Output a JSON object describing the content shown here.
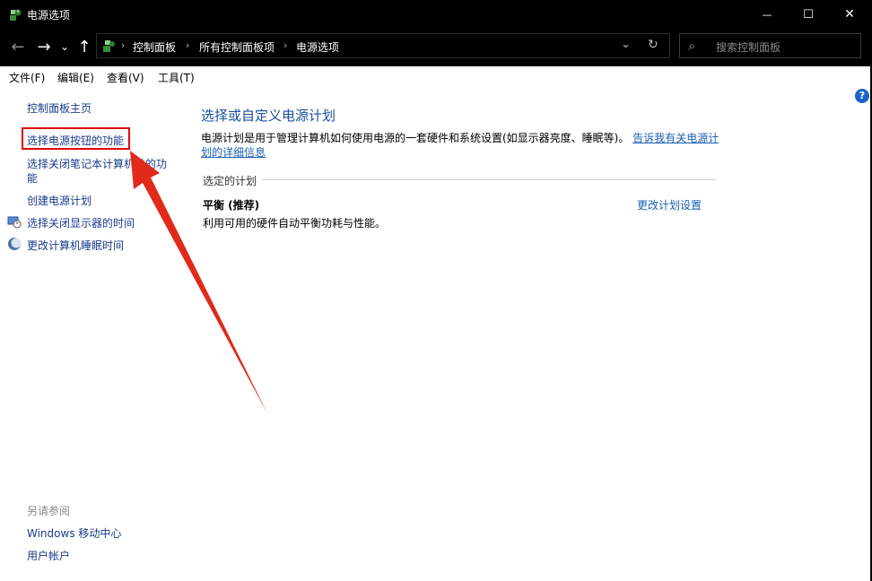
{
  "window": {
    "title": "电源选项",
    "minimize_glyph": "—",
    "maximize_glyph": "☐",
    "close_glyph": "✕"
  },
  "nav": {
    "back_glyph": "←",
    "forward_glyph": "→",
    "recent_glyph": "⌄",
    "up_glyph": "↑",
    "breadcrumbs": [
      "控制面板",
      "所有控制面板项",
      "电源选项"
    ],
    "breadcrumb_separator": "›",
    "dropdown_glyph": "⌄",
    "refresh_glyph": "↻",
    "search_placeholder": "搜索控制面板",
    "search_glyph": "⌕"
  },
  "menu": [
    "文件(F)",
    "编辑(E)",
    "查看(V)",
    "工具(T)"
  ],
  "sidebar": {
    "home_link": "控制面板主页",
    "links": [
      "选择电源按钮的功能",
      "选择关闭笔记本计算机盖的功",
      "能",
      "创建电源计划",
      "选择关闭显示器的时间",
      "更改计算机睡眠时间"
    ],
    "see_also_label": "另请参阅",
    "see_also_links": [
      "Windows 移动中心",
      "用户帐户"
    ]
  },
  "main": {
    "heading": "选择或自定义电源计划",
    "description": "电源计划是用于管理计算机如何使用电源的一套硬件和系统设置(如显示器亮度、睡眠等)。",
    "description_link_line1": "告诉我有关电源计",
    "description_link_line2": "划的详细信息",
    "selected_plan_label": "选定的计划",
    "plan_name": "平衡 (推荐)",
    "plan_description": "利用可用的硬件自动平衡功耗与性能。",
    "change_plan_link": "更改计划设置"
  },
  "help_glyph": "?",
  "colors": {
    "titlebar": "#000000",
    "link": "#1a5fb4",
    "heading": "#1a4fa0",
    "annotation": "#e10000"
  }
}
